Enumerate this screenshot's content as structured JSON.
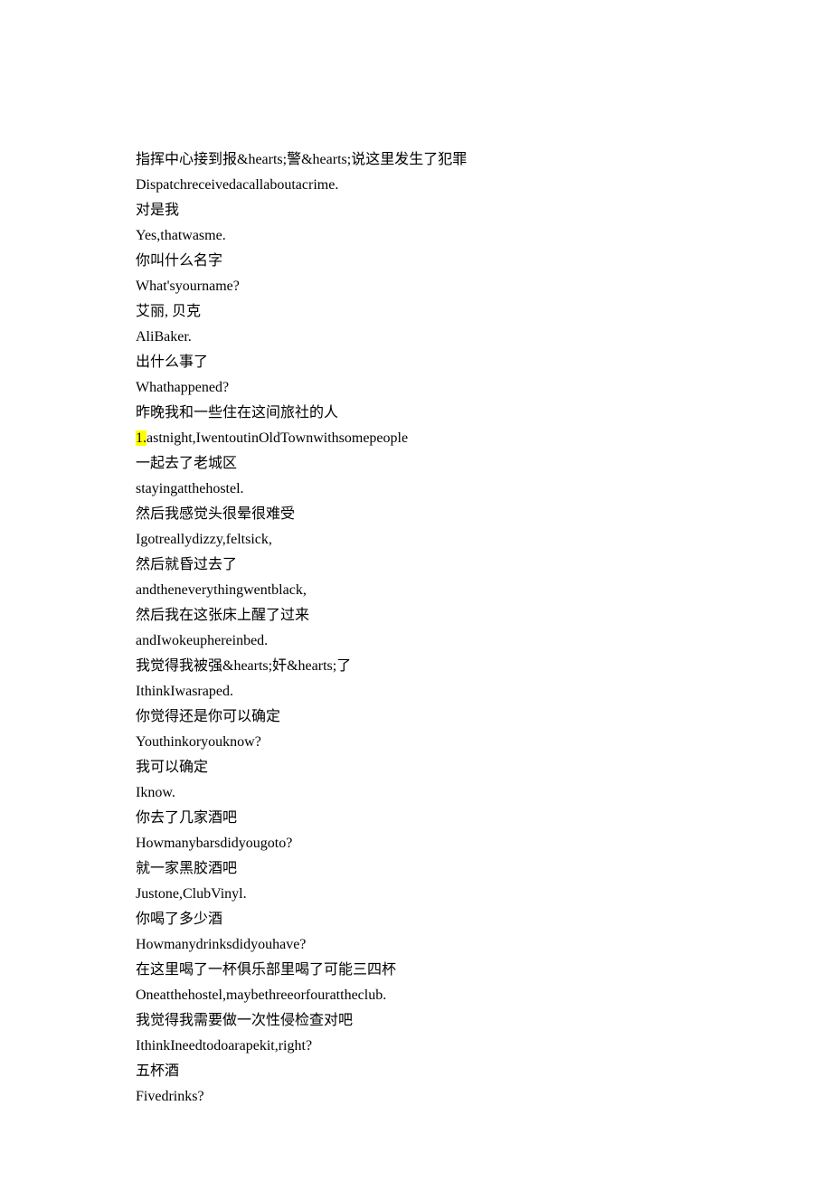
{
  "transcript": {
    "lines": [
      {
        "text": "指挥中心接到报&hearts;警&hearts;说这里发生了犯罪",
        "highlight": null
      },
      {
        "text": "Dispatchreceivedacallaboutacrime.",
        "highlight": null
      },
      {
        "text": "对是我",
        "highlight": null
      },
      {
        "text": "Yes,thatwasme.",
        "highlight": null
      },
      {
        "text": "你叫什么名字",
        "highlight": null
      },
      {
        "text": "What'syourname?",
        "highlight": null
      },
      {
        "text": "艾丽, 贝克",
        "highlight": null
      },
      {
        "text": "AliBaker.",
        "highlight": null
      },
      {
        "text": "出什么事了",
        "highlight": null
      },
      {
        "text": "Whathappened?",
        "highlight": null
      },
      {
        "text": "昨晚我和一些住在这间旅社的人",
        "highlight": null
      },
      {
        "text": "1.astnight,IwentoutinOldTownwithsomepeople",
        "highlight": "1."
      },
      {
        "text": "一起去了老城区",
        "highlight": null
      },
      {
        "text": "stayingatthehostel.",
        "highlight": null
      },
      {
        "text": "然后我感觉头很晕很难受",
        "highlight": null
      },
      {
        "text": "Igotreallydizzy,feltsick,",
        "highlight": null
      },
      {
        "text": "然后就昏过去了",
        "highlight": null
      },
      {
        "text": "andtheneverythingwentblack,",
        "highlight": null
      },
      {
        "text": "然后我在这张床上醒了过来",
        "highlight": null
      },
      {
        "text": "andIwokeuphereinbed.",
        "highlight": null
      },
      {
        "text": "我觉得我被强&hearts;奸&hearts;了",
        "highlight": null
      },
      {
        "text": "IthinkIwasraped.",
        "highlight": null
      },
      {
        "text": "你觉得还是你可以确定",
        "highlight": null
      },
      {
        "text": "Youthinkoryouknow?",
        "highlight": null
      },
      {
        "text": "我可以确定",
        "highlight": null
      },
      {
        "text": "Iknow.",
        "highlight": null
      },
      {
        "text": "你去了几家酒吧",
        "highlight": null
      },
      {
        "text": "Howmanybarsdidyougoto?",
        "highlight": null
      },
      {
        "text": "就一家黑胶酒吧",
        "highlight": null
      },
      {
        "text": "Justone,ClubVinyl.",
        "highlight": null
      },
      {
        "text": "你喝了多少酒",
        "highlight": null
      },
      {
        "text": "Howmanydrinksdidyouhave?",
        "highlight": null
      },
      {
        "text": "在这里喝了一杯俱乐部里喝了可能三四杯",
        "highlight": null
      },
      {
        "text": "Oneatthehostel,maybethreeorfourattheclub.",
        "highlight": null
      },
      {
        "text": "我觉得我需要做一次性侵检查对吧",
        "highlight": null
      },
      {
        "text": "IthinkIneedtodoarapekit,right?",
        "highlight": null
      },
      {
        "text": "五杯酒",
        "highlight": null
      },
      {
        "text": "Fivedrinks?",
        "highlight": null
      }
    ]
  }
}
